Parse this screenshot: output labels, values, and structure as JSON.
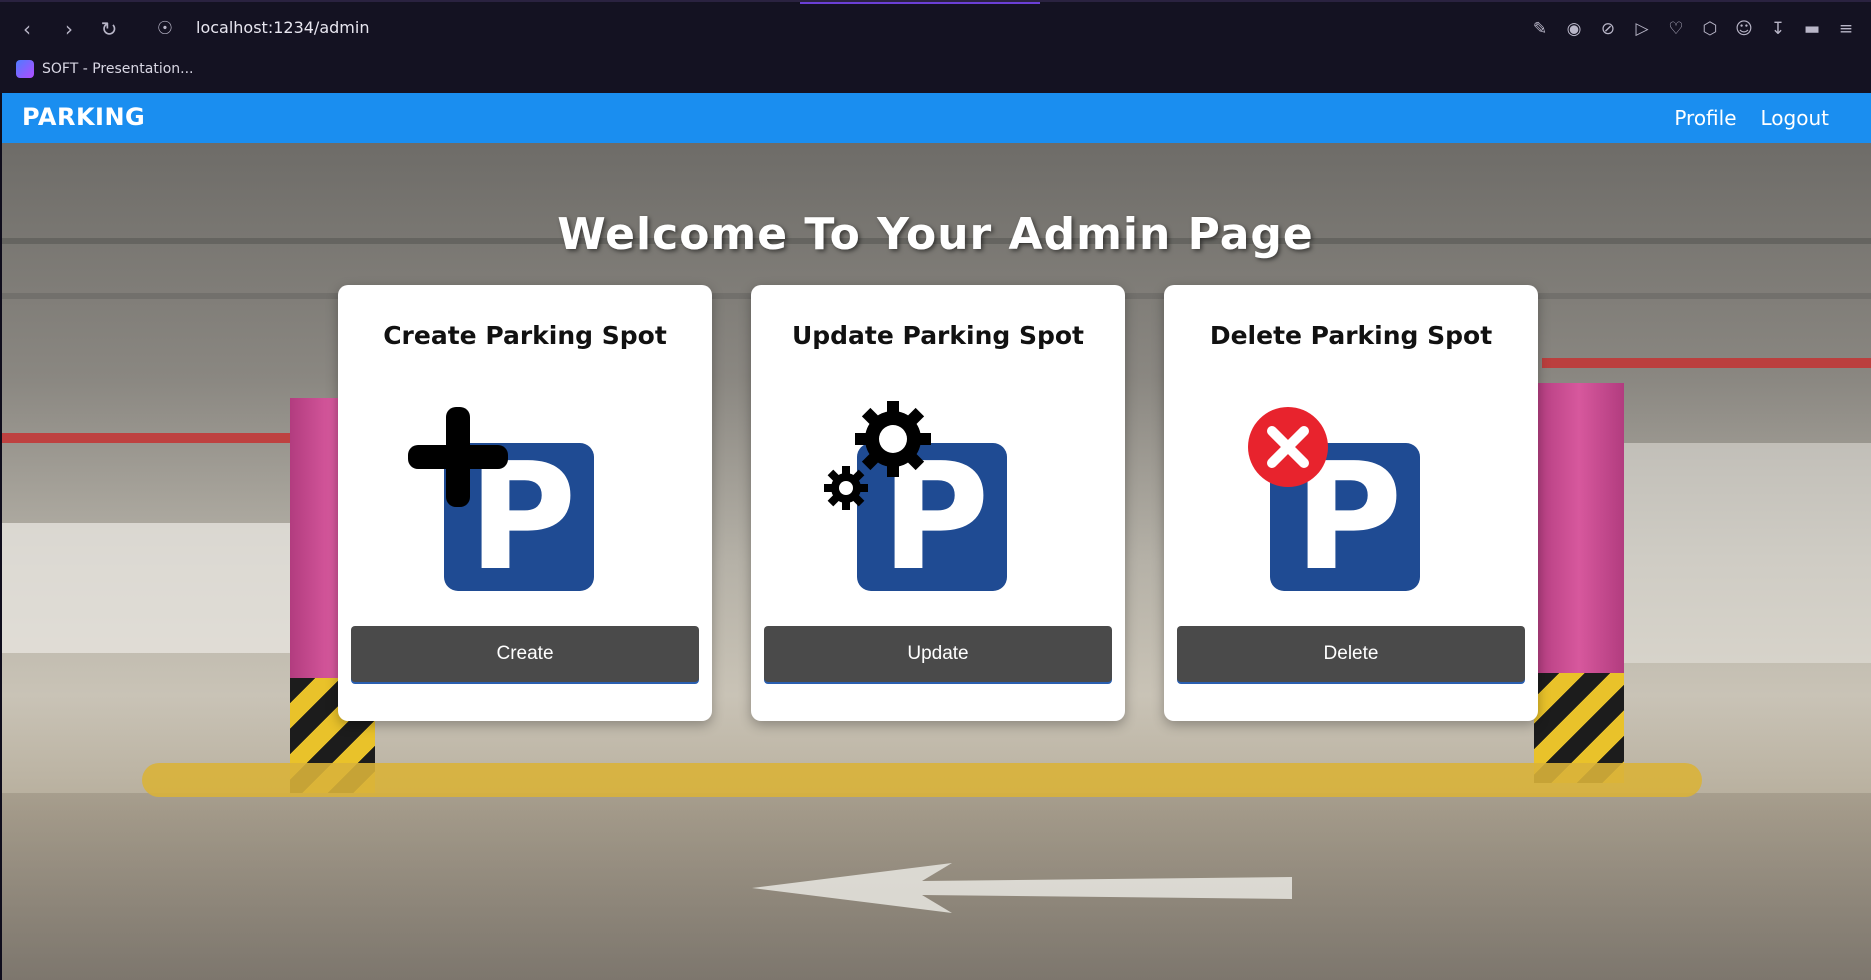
{
  "browser": {
    "url": "localhost:1234/admin",
    "bookmark_label": "SOFT - Presentation..."
  },
  "navbar": {
    "brand": "PARKING",
    "links": [
      {
        "label": "Profile"
      },
      {
        "label": "Logout"
      }
    ]
  },
  "main": {
    "title": "Welcome To Your Admin Page",
    "cards": [
      {
        "title": "Create Parking Spot",
        "button": "Create",
        "icon": "parking-add-icon"
      },
      {
        "title": "Update Parking Spot",
        "button": "Update",
        "icon": "parking-settings-icon"
      },
      {
        "title": "Delete Parking Spot",
        "button": "Delete",
        "icon": "parking-delete-icon"
      }
    ]
  },
  "colors": {
    "navbar": "#1a8ef0",
    "button": "#4a4a4a",
    "parking_sign": "#1f4b93",
    "delete_badge": "#e8232d"
  }
}
